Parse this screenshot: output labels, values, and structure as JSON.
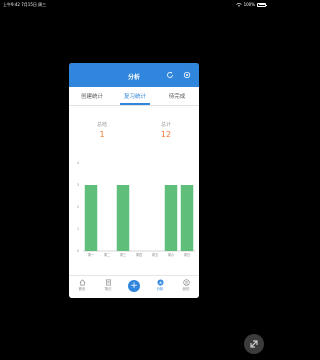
{
  "status_bar": {
    "time_date": "上午9:42  7月15日 周三",
    "battery": "100%"
  },
  "header": {
    "title": "分析"
  },
  "tabs": [
    {
      "label": "创建统计"
    },
    {
      "label": "复习统计"
    },
    {
      "label": "待完成"
    }
  ],
  "stats": {
    "left": {
      "label": "总结",
      "value": "1"
    },
    "right": {
      "label": "总计",
      "value": "12"
    }
  },
  "chart_data": {
    "type": "bar",
    "categories": [
      "周一",
      "周二",
      "周三",
      "周四",
      "周五",
      "周六",
      "周日"
    ],
    "values": [
      3,
      0,
      3,
      0,
      0,
      3,
      3
    ],
    "ylim": [
      0,
      4
    ],
    "yticks": [
      0,
      1,
      2,
      3,
      4
    ],
    "grid": false,
    "colors": {
      "bar": "#5fbf7a",
      "axis": "#999999"
    }
  },
  "tabbar": {
    "items": [
      {
        "label": "首页",
        "icon": "home-icon"
      },
      {
        "label": "笔记",
        "icon": "note-icon"
      },
      {
        "label": "",
        "icon": "plus-icon"
      },
      {
        "label": "分析",
        "icon": "analysis-icon"
      },
      {
        "label": "我的",
        "icon": "profile-icon"
      }
    ]
  },
  "colors": {
    "primary": "#2f86dc",
    "accent": "#f07a3a"
  }
}
